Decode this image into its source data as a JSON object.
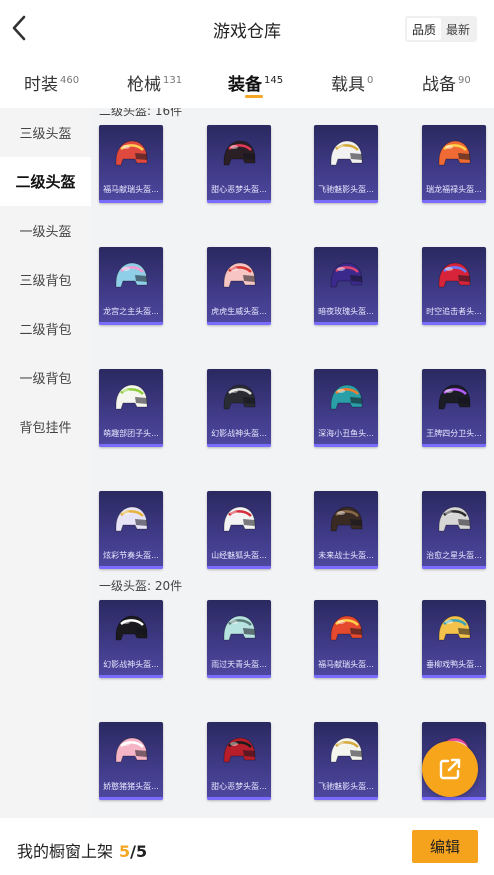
{
  "header": {
    "title": "游戏仓库",
    "sort_options": [
      "品质",
      "最新"
    ],
    "sort_selected": "品质"
  },
  "tabs": [
    {
      "label": "时装",
      "count": "460"
    },
    {
      "label": "枪械",
      "count": "131"
    },
    {
      "label": "装备",
      "count": "145",
      "active": true
    },
    {
      "label": "载具",
      "count": "0"
    },
    {
      "label": "战备",
      "count": "90"
    }
  ],
  "sidebar": {
    "items": [
      "三级头盔",
      "二级头盔",
      "一级头盔",
      "三级背包",
      "二级背包",
      "一级背包",
      "背包挂件"
    ],
    "active": "二级头盔"
  },
  "sections": [
    {
      "label": "二级头盔: 16件",
      "items": [
        {
          "name": "福马献瑞头盔",
          "helmet_color": "#e0493d",
          "accent": "#ffcc55"
        },
        {
          "name": "甜心恶梦头盔",
          "helmet_color": "#2a1f24",
          "accent": "#e23a57"
        },
        {
          "name": "飞驰魅影头盔",
          "helmet_color": "#f2f2f2",
          "accent": "#d4a93a"
        },
        {
          "name": "瑞龙福禄头盔",
          "helmet_color": "#f06a35",
          "accent": "#ffd24a"
        },
        {
          "name": "龙宫之主头盔",
          "helmet_color": "#8fd0e8",
          "accent": "#f59ad0"
        },
        {
          "name": "虎虎生威头盔",
          "helmet_color": "#f7c6c4",
          "accent": "#d8332f"
        },
        {
          "name": "暗夜玫瑰头盔",
          "helmet_color": "#3b2a8c",
          "accent": "#e04472"
        },
        {
          "name": "时空追击者头",
          "helmet_color": "#d8243a",
          "accent": "#6b7cff"
        },
        {
          "name": "萌趣部团子头",
          "helmet_color": "#f6f6f0",
          "accent": "#8fcf3c"
        },
        {
          "name": "幻影战神头盔",
          "helmet_color": "#2b2b33",
          "accent": "#dcdcdc"
        },
        {
          "name": "深海小丑鱼头",
          "helmet_color": "#2a9fa8",
          "accent": "#f37c2c"
        },
        {
          "name": "王牌四分卫头",
          "helmet_color": "#1c1c24",
          "accent": "#b85cff"
        },
        {
          "name": "炫彩节奏头盔",
          "helmet_color": "#e8e4f8",
          "accent": "#e7b33e"
        },
        {
          "name": "山经魅狐头盔",
          "helmet_color": "#f3f3f3",
          "accent": "#d42c3a"
        },
        {
          "name": "未来战士头盔",
          "helmet_color": "#3a2a24",
          "accent": "#8b6a4a"
        },
        {
          "name": "治愈之星头盔",
          "helmet_color": "#d6d6d6",
          "accent": "#2c2c2c"
        }
      ]
    },
    {
      "label": "一级头盔: 20件",
      "items": [
        {
          "name": "幻影战神头盔",
          "helmet_color": "#1a1a1f",
          "accent": "#ffffff"
        },
        {
          "name": "雨过天青头盔",
          "helmet_color": "#b6e3e0",
          "accent": "#5a7a78"
        },
        {
          "name": "福马献瑞头盔",
          "helmet_color": "#e64a2e",
          "accent": "#ffd24a"
        },
        {
          "name": "垂柳戏鸭头盔",
          "helmet_color": "#f2c24a",
          "accent": "#3aa4b8"
        },
        {
          "name": "娇憨猪猪头盔",
          "helmet_color": "#f6b5c6",
          "accent": "#ffffff"
        },
        {
          "name": "甜心恶梦头盔",
          "helmet_color": "#b81e2a",
          "accent": "#1a1a1a"
        },
        {
          "name": "飞驰魅影头盔",
          "helmet_color": "#f5f5f0",
          "accent": "#d4a93a"
        },
        {
          "name": "",
          "helmet_color": "#e64aa0",
          "accent": "#ffffff"
        }
      ]
    }
  ],
  "bottom_bar": {
    "showcase_label": "我的橱窗上架",
    "showcase_count": "5",
    "showcase_total": "/5",
    "edit_label": "编辑"
  },
  "icons": {
    "back": "chevron-left-icon",
    "share": "share-external-icon"
  },
  "colors": {
    "accent": "#f5a623",
    "card_bg": "#3f3a86"
  }
}
